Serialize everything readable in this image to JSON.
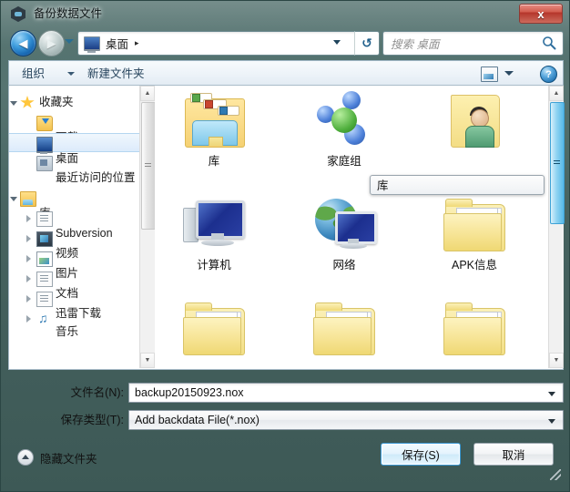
{
  "window": {
    "title": "备份数据文件",
    "app_icon": "shield-icon",
    "close_label": "x",
    "frame_color": "#4f6e6b"
  },
  "nav": {
    "back_glyph": "◀",
    "forward_glyph": "▶",
    "address_text": "桌面",
    "address_separator": "▸",
    "refresh_glyph": "↺",
    "search_placeholder": "搜索 桌面"
  },
  "toolbar": {
    "organize_label": "组织",
    "new_folder_label": "新建文件夹",
    "help_label": "?"
  },
  "sidebar": {
    "items": [
      {
        "label": "收藏夹",
        "icon": "star-icon",
        "level": 0,
        "expander": "open",
        "selected": false
      },
      {
        "label": "下载",
        "icon": "download-folder-icon",
        "level": 1,
        "expander": "none",
        "selected": false
      },
      {
        "label": "桌面",
        "icon": "desktop-icon",
        "level": 1,
        "expander": "none",
        "selected": true
      },
      {
        "label": "最近访问的位置",
        "icon": "recent-places-icon",
        "level": 1,
        "expander": "none",
        "selected": false
      },
      {
        "label": "库",
        "icon": "libraries-icon",
        "level": 0,
        "expander": "open",
        "selected": false
      },
      {
        "label": "Subversion",
        "icon": "document-icon",
        "level": 1,
        "expander": "closed",
        "selected": false
      },
      {
        "label": "视频",
        "icon": "video-icon",
        "level": 1,
        "expander": "closed",
        "selected": false
      },
      {
        "label": "图片",
        "icon": "pictures-icon",
        "level": 1,
        "expander": "closed",
        "selected": false
      },
      {
        "label": "文档",
        "icon": "document-icon",
        "level": 1,
        "expander": "closed",
        "selected": false
      },
      {
        "label": "迅雷下载",
        "icon": "document-icon",
        "level": 1,
        "expander": "closed",
        "selected": false
      },
      {
        "label": "音乐",
        "icon": "music-icon",
        "level": 1,
        "expander": "closed",
        "selected": false
      }
    ]
  },
  "files": {
    "items": [
      {
        "label": "库",
        "icon": "libraries-icon"
      },
      {
        "label": "家庭组",
        "icon": "homegroup-icon"
      },
      {
        "label": "",
        "icon": "user-folder-icon"
      },
      {
        "label": "计算机",
        "icon": "computer-icon"
      },
      {
        "label": "网络",
        "icon": "network-icon"
      },
      {
        "label": "APK信息",
        "icon": "folder-icon"
      },
      {
        "label": "",
        "icon": "folder-icon"
      },
      {
        "label": "",
        "icon": "folder-icon"
      },
      {
        "label": "",
        "icon": "folder-icon"
      }
    ]
  },
  "tooltip": {
    "text": "库"
  },
  "form": {
    "filename_label": "文件名(N):",
    "filename_value": "backup20150923.nox",
    "filetype_label": "保存类型(T):",
    "filetype_value": "Add backdata File(*.nox)"
  },
  "footer": {
    "hide_folders_label": "隐藏文件夹",
    "save_label": "保存(S)",
    "cancel_label": "取消"
  },
  "scrollbars": {
    "up_glyph": "▲",
    "down_glyph": "▼"
  }
}
